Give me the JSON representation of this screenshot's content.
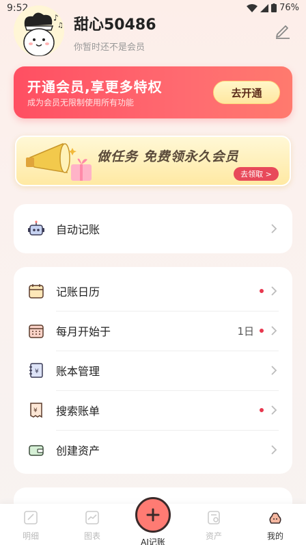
{
  "status_bar": {
    "time": "9:52",
    "battery": "76%"
  },
  "profile": {
    "username": "甜心50486",
    "member_status": "你暂时还不是会员"
  },
  "vip": {
    "title": "开通会员,享更多特权",
    "subtitle": "成为会员无限制使用所有功能",
    "button": "去开通"
  },
  "task_banner": {
    "title": "做任务 免费领永久会员",
    "button": "去领取 >"
  },
  "menu_group_1": [
    {
      "label": "自动记账",
      "icon": "robot-icon"
    }
  ],
  "menu_group_2": [
    {
      "label": "记账日历",
      "icon": "calendar-icon",
      "dot": true,
      "value": ""
    },
    {
      "label": "每月开始于",
      "icon": "calendar-grid-icon",
      "dot": true,
      "value": "1日"
    },
    {
      "label": "账本管理",
      "icon": "ledger-icon",
      "dot": false,
      "value": ""
    },
    {
      "label": "搜索账单",
      "icon": "bill-search-icon",
      "dot": true,
      "value": ""
    },
    {
      "label": "创建资产",
      "icon": "wallet-icon",
      "dot": false,
      "value": ""
    }
  ],
  "tabs": [
    {
      "label": "明细",
      "icon": "detail-icon",
      "active": false
    },
    {
      "label": "图表",
      "icon": "chart-icon",
      "active": false
    },
    {
      "label": "AI记账",
      "icon": "plus-icon",
      "active": false
    },
    {
      "label": "资产",
      "icon": "asset-icon",
      "active": false
    },
    {
      "label": "我的",
      "icon": "mine-icon",
      "active": true
    }
  ],
  "colors": {
    "accent_red": "#ff5a68",
    "dot_red": "#e8384f",
    "gold": "#ffe7a0"
  }
}
